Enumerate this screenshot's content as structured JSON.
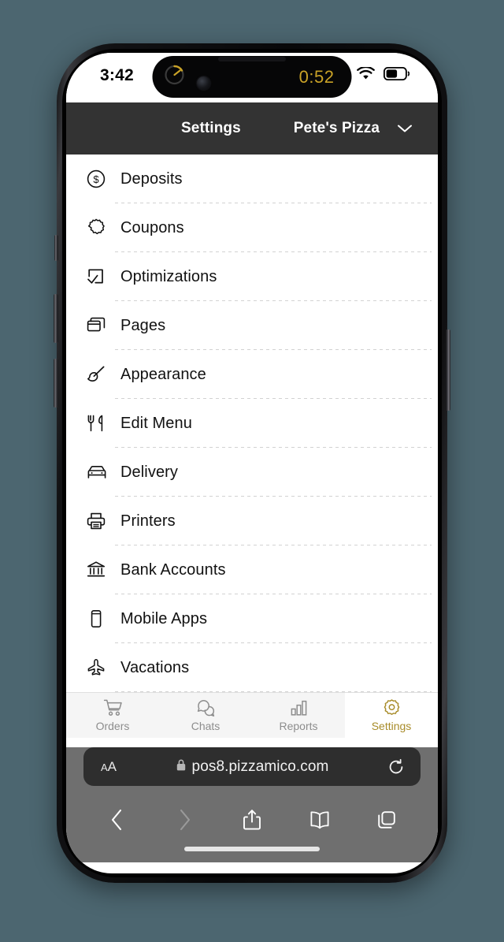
{
  "status_bar": {
    "time": "3:42",
    "dynamic_island": {
      "timer_value": "0:52",
      "timer_icon": "timer-ring-icon",
      "accent_color": "#c9a227"
    },
    "wifi_icon": "wifi-icon",
    "battery_icon": "battery-icon",
    "battery_level_pct": 52
  },
  "app_header": {
    "title": "Settings",
    "store_name": "Pete's Pizza",
    "caret_icon": "chevron-down-icon",
    "background_color": "#333333"
  },
  "settings_list": {
    "items": [
      {
        "label": "Deposits",
        "icon": "dollar-circle-icon"
      },
      {
        "label": "Coupons",
        "icon": "coupon-badge-icon"
      },
      {
        "label": "Optimizations",
        "icon": "checkbox-check-icon"
      },
      {
        "label": "Pages",
        "icon": "pages-stack-icon"
      },
      {
        "label": "Appearance",
        "icon": "paintbrush-icon"
      },
      {
        "label": "Edit Menu",
        "icon": "fork-knife-icon"
      },
      {
        "label": "Delivery",
        "icon": "car-icon"
      },
      {
        "label": "Printers",
        "icon": "printer-icon"
      },
      {
        "label": "Bank Accounts",
        "icon": "bank-icon"
      },
      {
        "label": "Mobile Apps",
        "icon": "mobile-phone-icon"
      },
      {
        "label": "Vacations",
        "icon": "airplane-icon"
      }
    ]
  },
  "tab_bar": {
    "active_color": "#a88c2a",
    "inactive_color": "#8d8d8d",
    "tabs": [
      {
        "label": "Orders",
        "icon": "shopping-cart-icon",
        "active": false
      },
      {
        "label": "Chats",
        "icon": "chat-bubbles-icon",
        "active": false
      },
      {
        "label": "Reports",
        "icon": "bar-chart-icon",
        "active": false
      },
      {
        "label": "Settings",
        "icon": "gear-icon",
        "active": true
      }
    ]
  },
  "browser": {
    "text_size_label": "AA",
    "lock_icon": "lock-icon",
    "url": "pos8.pizzamico.com",
    "reload_icon": "reload-icon",
    "toolbar": [
      {
        "name": "back",
        "icon": "chevron-left-icon",
        "enabled": true
      },
      {
        "name": "forward",
        "icon": "chevron-right-icon",
        "enabled": false
      },
      {
        "name": "share",
        "icon": "share-icon",
        "enabled": true
      },
      {
        "name": "bookmarks",
        "icon": "book-icon",
        "enabled": true
      },
      {
        "name": "tabs",
        "icon": "tabs-icon",
        "enabled": true
      }
    ]
  }
}
